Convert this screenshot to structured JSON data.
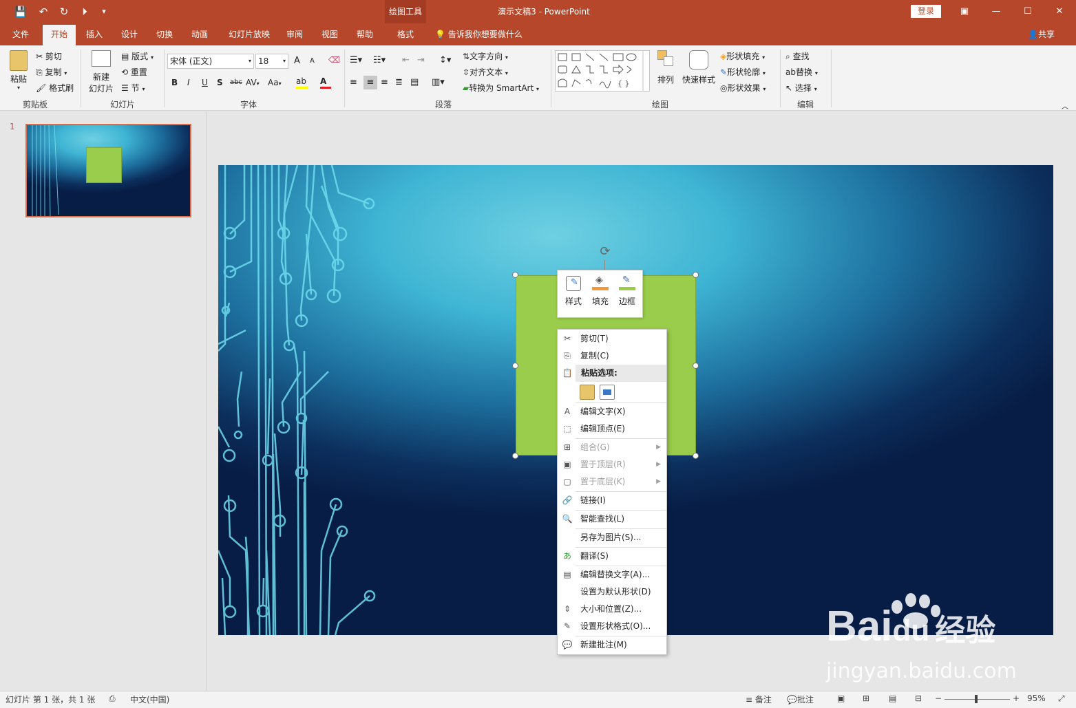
{
  "titlebar": {
    "context_group": "绘图工具",
    "doc_title": "演示文稿3  -  PowerPoint",
    "login": "登录",
    "qat": {
      "save": "💾",
      "undo": "↶",
      "redo": "↻",
      "present": "⏵",
      "more": "▾"
    },
    "win": {
      "ribbon_opts": "▣",
      "minimize": "—",
      "maximize": "☐",
      "close": "✕"
    }
  },
  "tabs": [
    "文件",
    "开始",
    "插入",
    "设计",
    "切换",
    "动画",
    "幻灯片放映",
    "审阅",
    "视图",
    "帮助",
    "格式"
  ],
  "tellme": "告诉我你想要做什么",
  "share": "共享",
  "ribbon": {
    "clipboard": {
      "paste": "粘贴",
      "cut": "剪切",
      "copy": "复制",
      "format_painter": "格式刷",
      "label": "剪贴板"
    },
    "slides": {
      "new_line1": "新建",
      "new_line2": "幻灯片",
      "layout": "版式",
      "reset": "重置",
      "section": "节",
      "label": "幻灯片"
    },
    "font": {
      "name": "宋体 (正文)",
      "size": "18",
      "label": "字体",
      "bold": "B",
      "italic": "I",
      "underline": "U",
      "shadow": "S",
      "strike": "abc",
      "spacing": "AV",
      "case": "Aa",
      "grow": "A",
      "shrink": "A"
    },
    "paragraph": {
      "text_direction": "文字方向",
      "align_text": "对齐文本",
      "smartart": "转换为 SmartArt",
      "label": "段落"
    },
    "drawing": {
      "arrange": "排列",
      "quick_styles": "快速样式",
      "fill": "形状填充",
      "outline": "形状轮廓",
      "effects": "形状效果",
      "label": "绘图"
    },
    "editing": {
      "find": "查找",
      "replace": "替换",
      "select": "选择",
      "label": "编辑"
    }
  },
  "thumbs": {
    "number": "1"
  },
  "minitoolbar": {
    "style": "样式",
    "fill": "填充",
    "border": "边框"
  },
  "context_menu": [
    {
      "label": "剪切(T)",
      "icon": "✂",
      "disabled": false
    },
    {
      "label": "复制(C)",
      "icon": "⎘",
      "disabled": false
    },
    {
      "label": "粘贴选项:",
      "icon": "📋",
      "disabled": false
    },
    {
      "label": "编辑文字(X)",
      "icon": "A",
      "disabled": false
    },
    {
      "label": "编辑顶点(E)",
      "icon": "⬚",
      "disabled": false
    },
    {
      "label": "组合(G)",
      "icon": "⊞",
      "disabled": true
    },
    {
      "label": "置于顶层(R)",
      "icon": "▣",
      "disabled": true
    },
    {
      "label": "置于底层(K)",
      "icon": "▢",
      "disabled": true
    },
    {
      "label": "链接(I)",
      "icon": "🔗",
      "disabled": false
    },
    {
      "label": "智能查找(L)",
      "icon": "🔍",
      "disabled": false
    },
    {
      "label": "另存为图片(S)...",
      "icon": "",
      "disabled": false
    },
    {
      "label": "翻译(S)",
      "icon": "あ",
      "disabled": false
    },
    {
      "label": "编辑替换文字(A)...",
      "icon": "▤",
      "disabled": false
    },
    {
      "label": "设置为默认形状(D)",
      "icon": "",
      "disabled": false
    },
    {
      "label": "大小和位置(Z)...",
      "icon": "⇕",
      "disabled": false
    },
    {
      "label": "设置形状格式(O)...",
      "icon": "✎",
      "disabled": false
    },
    {
      "label": "新建批注(M)",
      "icon": "💬",
      "disabled": false
    }
  ],
  "status": {
    "slide_info": "幻灯片 第 1 张，共 1 张",
    "language": "中文(中国)",
    "notes": "备注",
    "comments": "批注",
    "zoom": "95%"
  },
  "watermark": {
    "brand": "Bai",
    "brand2": "du",
    "cn": "经验",
    "url": "jingyan.baidu.com"
  },
  "colors": {
    "accent": "#b7472a",
    "shape_fill": "#9acd4b"
  }
}
